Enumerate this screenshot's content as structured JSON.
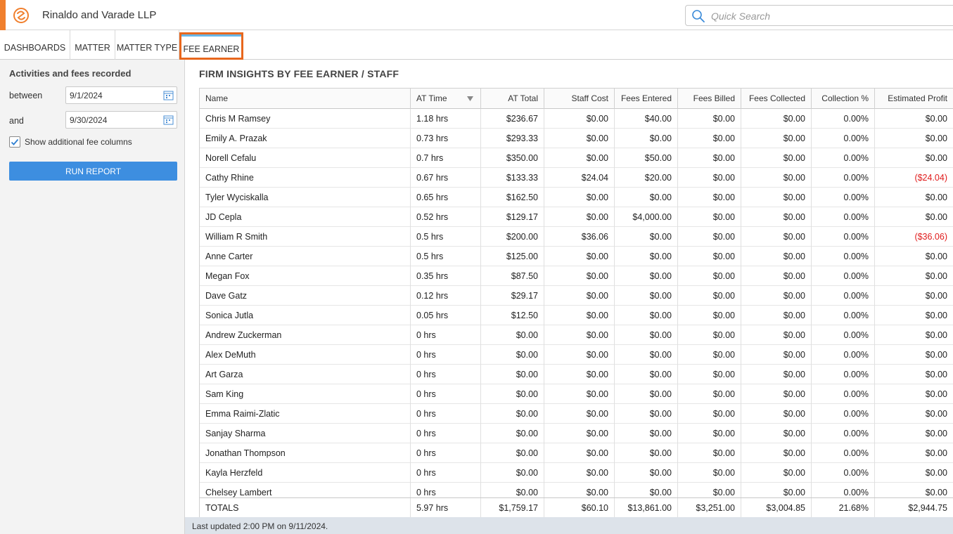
{
  "header": {
    "firm_name": "Rinaldo and Varade LLP",
    "search_placeholder": "Quick Search",
    "accent_color": "#f07f2d"
  },
  "tabs": [
    {
      "label": "DASHBOARDS"
    },
    {
      "label": "MATTER"
    },
    {
      "label": "MATTER TYPE"
    },
    {
      "label": "FEE EARNER",
      "active": true
    }
  ],
  "sidebar": {
    "title": "Activities and fees recorded",
    "between_label": "between",
    "between_value": "9/1/2024",
    "and_label": "and",
    "and_value": "9/30/2024",
    "checkbox_label": "Show additional fee columns",
    "checkbox_checked": true,
    "run_label": "RUN REPORT",
    "run_color": "#3d8ee0"
  },
  "report": {
    "title": "FIRM INSIGHTS BY FEE EARNER / STAFF",
    "columns": [
      "Name",
      "AT Time",
      "AT Total",
      "Staff Cost",
      "Fees Entered",
      "Fees Billed",
      "Fees Collected",
      "Collection %",
      "Estimated Profit"
    ],
    "rows": [
      [
        "Chris M Ramsey",
        "1.18 hrs",
        "$236.67",
        "$0.00",
        "$40.00",
        "$0.00",
        "$0.00",
        "0.00%",
        "$0.00"
      ],
      [
        "Emily A. Prazak",
        "0.73 hrs",
        "$293.33",
        "$0.00",
        "$0.00",
        "$0.00",
        "$0.00",
        "0.00%",
        "$0.00"
      ],
      [
        "Norell Cefalu",
        "0.7 hrs",
        "$350.00",
        "$0.00",
        "$50.00",
        "$0.00",
        "$0.00",
        "0.00%",
        "$0.00"
      ],
      [
        "Cathy Rhine",
        "0.67 hrs",
        "$133.33",
        "$24.04",
        "$20.00",
        "$0.00",
        "$0.00",
        "0.00%",
        "($24.04)"
      ],
      [
        "Tyler Wyciskalla",
        "0.65 hrs",
        "$162.50",
        "$0.00",
        "$0.00",
        "$0.00",
        "$0.00",
        "0.00%",
        "$0.00"
      ],
      [
        "JD Cepla",
        "0.52 hrs",
        "$129.17",
        "$0.00",
        "$4,000.00",
        "$0.00",
        "$0.00",
        "0.00%",
        "$0.00"
      ],
      [
        "William R Smith",
        "0.5 hrs",
        "$200.00",
        "$36.06",
        "$0.00",
        "$0.00",
        "$0.00",
        "0.00%",
        "($36.06)"
      ],
      [
        "Anne Carter",
        "0.5 hrs",
        "$125.00",
        "$0.00",
        "$0.00",
        "$0.00",
        "$0.00",
        "0.00%",
        "$0.00"
      ],
      [
        "Megan Fox",
        "0.35 hrs",
        "$87.50",
        "$0.00",
        "$0.00",
        "$0.00",
        "$0.00",
        "0.00%",
        "$0.00"
      ],
      [
        "Dave Gatz",
        "0.12 hrs",
        "$29.17",
        "$0.00",
        "$0.00",
        "$0.00",
        "$0.00",
        "0.00%",
        "$0.00"
      ],
      [
        "Sonica Jutla",
        "0.05 hrs",
        "$12.50",
        "$0.00",
        "$0.00",
        "$0.00",
        "$0.00",
        "0.00%",
        "$0.00"
      ],
      [
        "Andrew Zuckerman",
        "0 hrs",
        "$0.00",
        "$0.00",
        "$0.00",
        "$0.00",
        "$0.00",
        "0.00%",
        "$0.00"
      ],
      [
        "Alex DeMuth",
        "0 hrs",
        "$0.00",
        "$0.00",
        "$0.00",
        "$0.00",
        "$0.00",
        "0.00%",
        "$0.00"
      ],
      [
        "Art Garza",
        "0 hrs",
        "$0.00",
        "$0.00",
        "$0.00",
        "$0.00",
        "$0.00",
        "0.00%",
        "$0.00"
      ],
      [
        "Sam King",
        "0 hrs",
        "$0.00",
        "$0.00",
        "$0.00",
        "$0.00",
        "$0.00",
        "0.00%",
        "$0.00"
      ],
      [
        "Emma  Raimi-Zlatic",
        "0 hrs",
        "$0.00",
        "$0.00",
        "$0.00",
        "$0.00",
        "$0.00",
        "0.00%",
        "$0.00"
      ],
      [
        "Sanjay Sharma",
        "0 hrs",
        "$0.00",
        "$0.00",
        "$0.00",
        "$0.00",
        "$0.00",
        "0.00%",
        "$0.00"
      ],
      [
        "Jonathan  Thompson",
        "0 hrs",
        "$0.00",
        "$0.00",
        "$0.00",
        "$0.00",
        "$0.00",
        "0.00%",
        "$0.00"
      ],
      [
        "Kayla  Herzfeld",
        "0 hrs",
        "$0.00",
        "$0.00",
        "$0.00",
        "$0.00",
        "$0.00",
        "0.00%",
        "$0.00"
      ],
      [
        "Chelsey Lambert",
        "0 hrs",
        "$0.00",
        "$0.00",
        "$0.00",
        "$0.00",
        "$0.00",
        "0.00%",
        "$0.00"
      ]
    ],
    "totals": [
      "TOTALS",
      "5.97 hrs",
      "$1,759.17",
      "$60.10",
      "$13,861.00",
      "$3,251.00",
      "$3,004.85",
      "21.68%",
      "$2,944.75"
    ],
    "negative_color": "#e01b1b",
    "footer": "Last updated 2:00 PM on 9/11/2024."
  }
}
